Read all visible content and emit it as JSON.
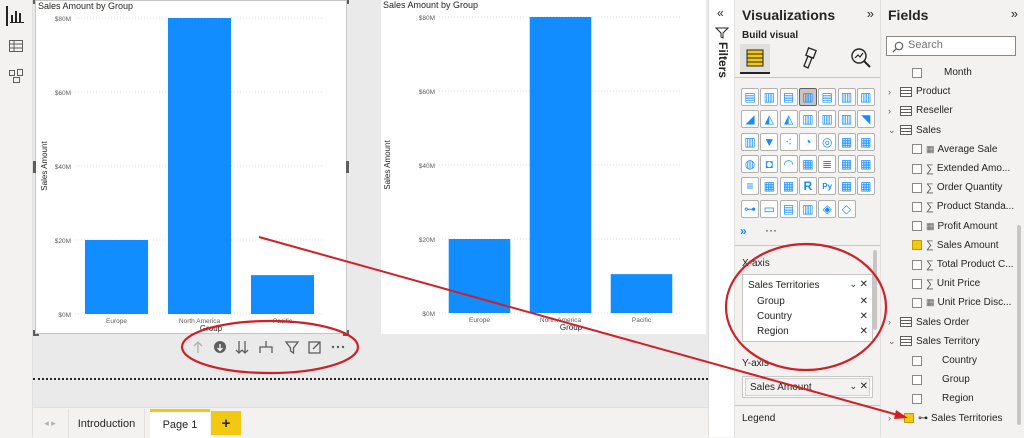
{
  "charts": {
    "left": {
      "title": "Sales Amount by Group",
      "ylabel": "Sales Amount",
      "xlabel": "Group"
    },
    "right": {
      "title": "Sales Amount by Group",
      "ylabel": "Sales Amount",
      "xlabel": "Group"
    }
  },
  "chart_data": [
    {
      "type": "bar",
      "title": "Sales Amount by Group",
      "categories": [
        "Europe",
        "North America",
        "Pacific"
      ],
      "values": [
        20,
        80,
        10.5
      ],
      "xlabel": "Group",
      "ylabel": "Sales Amount",
      "yticks": [
        "$0M",
        "$20M",
        "$40M",
        "$60M",
        "$80M"
      ],
      "ylim": [
        0,
        80
      ],
      "color": "#118dff"
    },
    {
      "type": "bar",
      "title": "Sales Amount by Group",
      "categories": [
        "Europe",
        "North America",
        "Pacific"
      ],
      "values": [
        20,
        80,
        10.5
      ],
      "xlabel": "Group",
      "ylabel": "Sales Amount",
      "yticks": [
        "$0M",
        "$20M",
        "$40M",
        "$60M",
        "$80M"
      ],
      "ylim": [
        0,
        80
      ],
      "color": "#118dff"
    }
  ],
  "pages": {
    "tabs": [
      "Introduction",
      "Page 1"
    ],
    "active": "Page 1",
    "add": "+"
  },
  "filters": {
    "label": "Filters"
  },
  "viz": {
    "title": "Visualizations",
    "build_visual": "Build visual",
    "more": "···",
    "xaxis": {
      "label": "X-axis",
      "hierarchy": "Sales Territories",
      "levels": [
        "Group",
        "Country",
        "Region"
      ]
    },
    "yaxis": {
      "label": "Y-axis",
      "field": "Sales Amount"
    },
    "legend": {
      "label": "Legend"
    }
  },
  "fields": {
    "title": "Fields",
    "search_placeholder": "Search",
    "month": "Month",
    "tables": [
      "Product",
      "Reseller",
      "Sales"
    ],
    "sales_fields": [
      {
        "name": "Average Sale",
        "checked": false
      },
      {
        "name": "Extended Amo...",
        "checked": false
      },
      {
        "name": "Order Quantity",
        "checked": false
      },
      {
        "name": "Product Standa...",
        "checked": false
      },
      {
        "name": "Profit Amount",
        "checked": false
      },
      {
        "name": "Sales Amount",
        "checked": true
      },
      {
        "name": "Total Product C...",
        "checked": false
      },
      {
        "name": "Unit Price",
        "checked": false
      },
      {
        "name": "Unit Price Disc...",
        "checked": false
      }
    ],
    "sales_order": "Sales Order",
    "sales_territory": "Sales Territory",
    "territory_fields": [
      "Country",
      "Group",
      "Region"
    ],
    "hierarchy": "Sales Territories"
  }
}
